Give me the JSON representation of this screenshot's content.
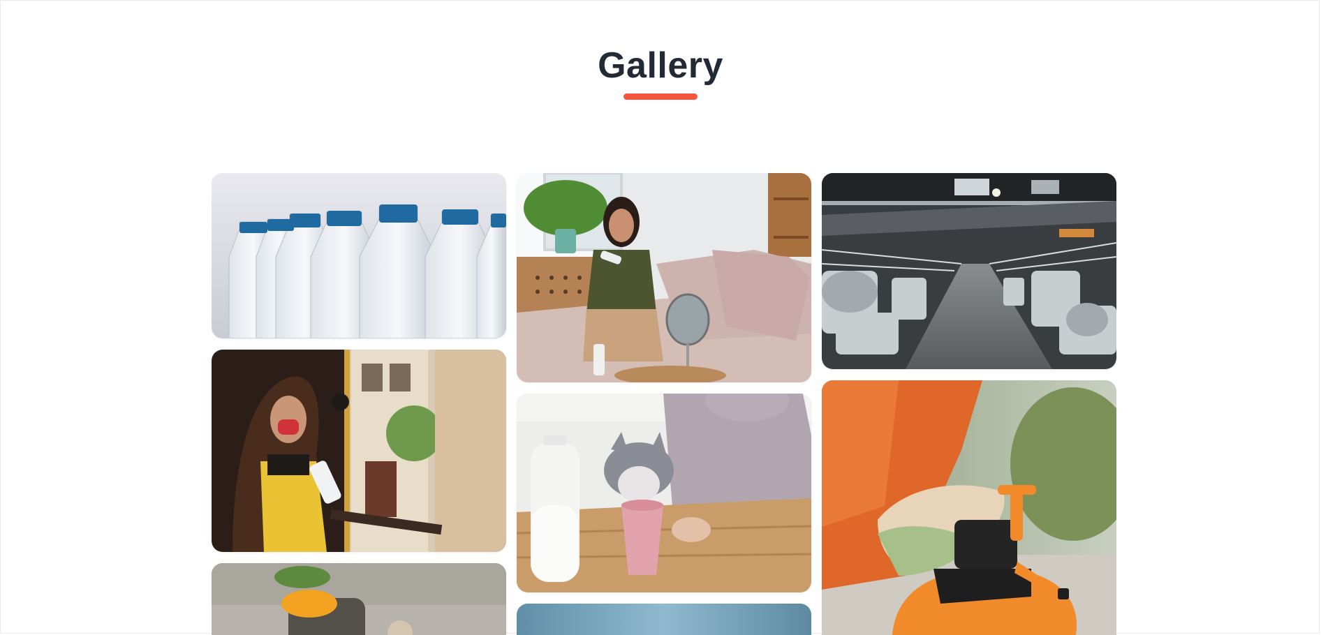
{
  "header": {
    "title": "Gallery",
    "accent_color": "#f5553f"
  },
  "gallery": {
    "columns": [
      {
        "items": [
          {
            "subject": "water-bottles"
          },
          {
            "subject": "woman-mask-sanitizer"
          },
          {
            "subject": "spray-jar-outdoor"
          }
        ]
      },
      {
        "items": [
          {
            "subject": "woman-sofa-lotion"
          },
          {
            "subject": "cat-drinking-milk"
          },
          {
            "subject": "blue-backdrop"
          }
        ]
      },
      {
        "items": [
          {
            "subject": "factory-interior"
          },
          {
            "subject": "orange-pressure-sprayer"
          }
        ]
      }
    ]
  }
}
